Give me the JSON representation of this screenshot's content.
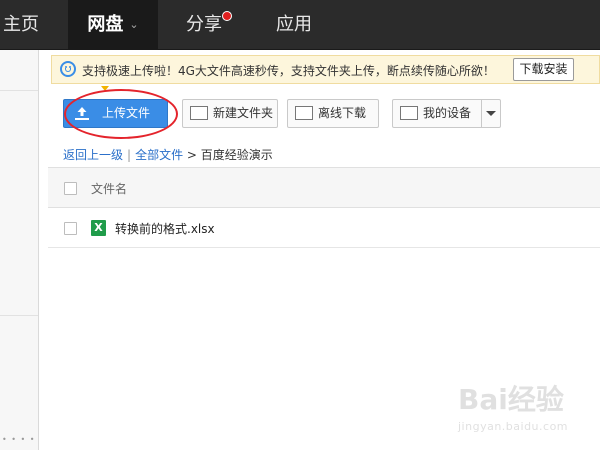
{
  "nav": {
    "home": "主页",
    "pan": "网盘",
    "share": "分享",
    "apps": "应用"
  },
  "notice": {
    "icon": "smile-icon",
    "text": "支持极速上传啦！4G大文件高速秒传，支持文件夹上传，断点续传随心所欲！",
    "install_button": "下载安装"
  },
  "toolbar": {
    "upload": "上传文件",
    "new_folder": "新建文件夹",
    "offline": "离线下载",
    "device": "我的设备"
  },
  "breadcrumb": {
    "back": "返回上一级",
    "divider": "|",
    "all_files": "全部文件",
    "arrow": ">",
    "current": "百度经验演示"
  },
  "file_list": {
    "header_name": "文件名",
    "files": [
      {
        "name": "转换前的格式.xlsx",
        "type_letter": "X"
      }
    ]
  },
  "watermark": {
    "logo": "Bai经验",
    "url": "jingyan.baidu.com"
  },
  "colors": {
    "topbar": "#2b2b2b",
    "upload_button": "#3a8de6",
    "annotation_circle": "#e4242c",
    "notice_bg": "#fdf6dc",
    "excel_green": "#1f9c4a"
  }
}
